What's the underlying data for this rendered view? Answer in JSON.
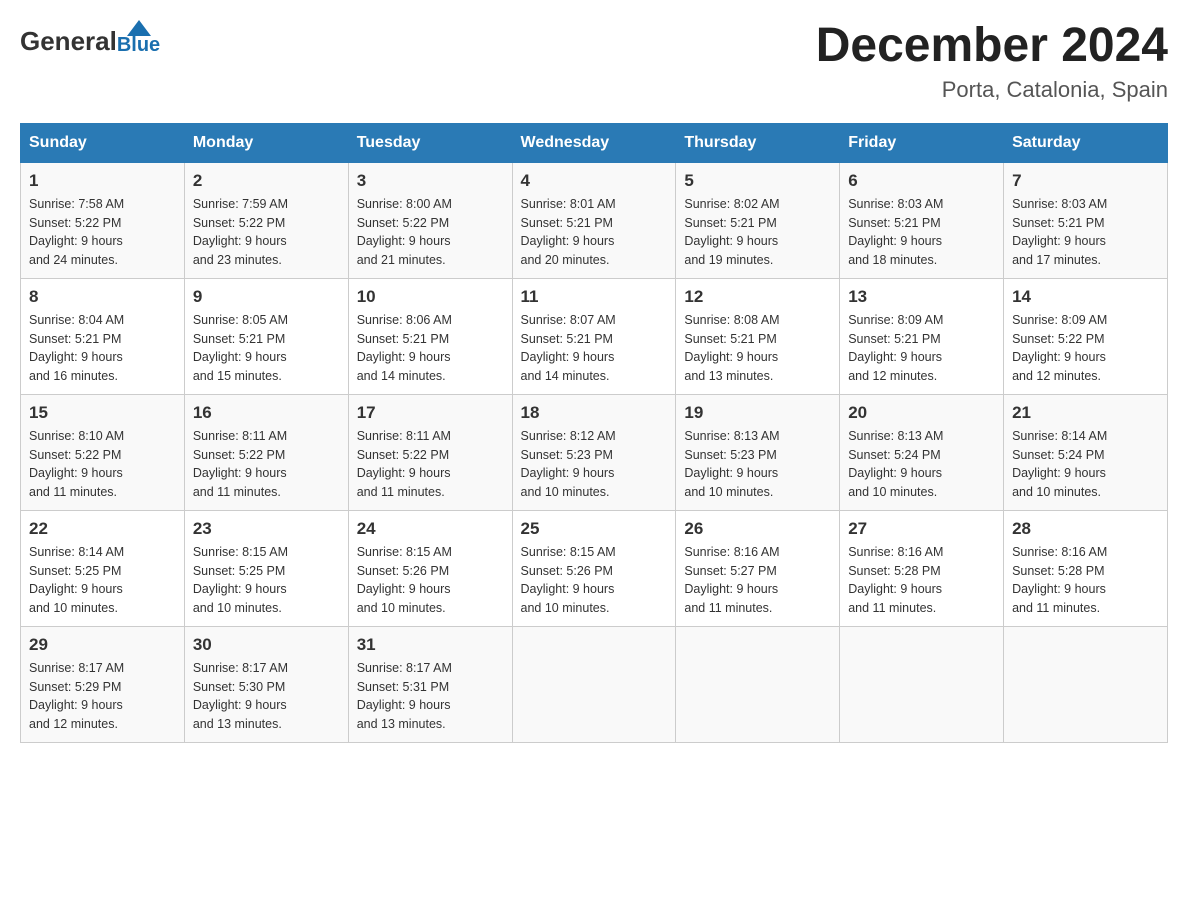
{
  "header": {
    "title": "December 2024",
    "subtitle": "Porta, Catalonia, Spain",
    "logo_general": "General",
    "logo_blue": "Blue"
  },
  "days_of_week": [
    "Sunday",
    "Monday",
    "Tuesday",
    "Wednesday",
    "Thursday",
    "Friday",
    "Saturday"
  ],
  "weeks": [
    [
      {
        "day": "1",
        "sunrise": "7:58 AM",
        "sunset": "5:22 PM",
        "daylight": "9 hours and 24 minutes."
      },
      {
        "day": "2",
        "sunrise": "7:59 AM",
        "sunset": "5:22 PM",
        "daylight": "9 hours and 23 minutes."
      },
      {
        "day": "3",
        "sunrise": "8:00 AM",
        "sunset": "5:22 PM",
        "daylight": "9 hours and 21 minutes."
      },
      {
        "day": "4",
        "sunrise": "8:01 AM",
        "sunset": "5:21 PM",
        "daylight": "9 hours and 20 minutes."
      },
      {
        "day": "5",
        "sunrise": "8:02 AM",
        "sunset": "5:21 PM",
        "daylight": "9 hours and 19 minutes."
      },
      {
        "day": "6",
        "sunrise": "8:03 AM",
        "sunset": "5:21 PM",
        "daylight": "9 hours and 18 minutes."
      },
      {
        "day": "7",
        "sunrise": "8:03 AM",
        "sunset": "5:21 PM",
        "daylight": "9 hours and 17 minutes."
      }
    ],
    [
      {
        "day": "8",
        "sunrise": "8:04 AM",
        "sunset": "5:21 PM",
        "daylight": "9 hours and 16 minutes."
      },
      {
        "day": "9",
        "sunrise": "8:05 AM",
        "sunset": "5:21 PM",
        "daylight": "9 hours and 15 minutes."
      },
      {
        "day": "10",
        "sunrise": "8:06 AM",
        "sunset": "5:21 PM",
        "daylight": "9 hours and 14 minutes."
      },
      {
        "day": "11",
        "sunrise": "8:07 AM",
        "sunset": "5:21 PM",
        "daylight": "9 hours and 14 minutes."
      },
      {
        "day": "12",
        "sunrise": "8:08 AM",
        "sunset": "5:21 PM",
        "daylight": "9 hours and 13 minutes."
      },
      {
        "day": "13",
        "sunrise": "8:09 AM",
        "sunset": "5:21 PM",
        "daylight": "9 hours and 12 minutes."
      },
      {
        "day": "14",
        "sunrise": "8:09 AM",
        "sunset": "5:22 PM",
        "daylight": "9 hours and 12 minutes."
      }
    ],
    [
      {
        "day": "15",
        "sunrise": "8:10 AM",
        "sunset": "5:22 PM",
        "daylight": "9 hours and 11 minutes."
      },
      {
        "day": "16",
        "sunrise": "8:11 AM",
        "sunset": "5:22 PM",
        "daylight": "9 hours and 11 minutes."
      },
      {
        "day": "17",
        "sunrise": "8:11 AM",
        "sunset": "5:22 PM",
        "daylight": "9 hours and 11 minutes."
      },
      {
        "day": "18",
        "sunrise": "8:12 AM",
        "sunset": "5:23 PM",
        "daylight": "9 hours and 10 minutes."
      },
      {
        "day": "19",
        "sunrise": "8:13 AM",
        "sunset": "5:23 PM",
        "daylight": "9 hours and 10 minutes."
      },
      {
        "day": "20",
        "sunrise": "8:13 AM",
        "sunset": "5:24 PM",
        "daylight": "9 hours and 10 minutes."
      },
      {
        "day": "21",
        "sunrise": "8:14 AM",
        "sunset": "5:24 PM",
        "daylight": "9 hours and 10 minutes."
      }
    ],
    [
      {
        "day": "22",
        "sunrise": "8:14 AM",
        "sunset": "5:25 PM",
        "daylight": "9 hours and 10 minutes."
      },
      {
        "day": "23",
        "sunrise": "8:15 AM",
        "sunset": "5:25 PM",
        "daylight": "9 hours and 10 minutes."
      },
      {
        "day": "24",
        "sunrise": "8:15 AM",
        "sunset": "5:26 PM",
        "daylight": "9 hours and 10 minutes."
      },
      {
        "day": "25",
        "sunrise": "8:15 AM",
        "sunset": "5:26 PM",
        "daylight": "9 hours and 10 minutes."
      },
      {
        "day": "26",
        "sunrise": "8:16 AM",
        "sunset": "5:27 PM",
        "daylight": "9 hours and 11 minutes."
      },
      {
        "day": "27",
        "sunrise": "8:16 AM",
        "sunset": "5:28 PM",
        "daylight": "9 hours and 11 minutes."
      },
      {
        "day": "28",
        "sunrise": "8:16 AM",
        "sunset": "5:28 PM",
        "daylight": "9 hours and 11 minutes."
      }
    ],
    [
      {
        "day": "29",
        "sunrise": "8:17 AM",
        "sunset": "5:29 PM",
        "daylight": "9 hours and 12 minutes."
      },
      {
        "day": "30",
        "sunrise": "8:17 AM",
        "sunset": "5:30 PM",
        "daylight": "9 hours and 13 minutes."
      },
      {
        "day": "31",
        "sunrise": "8:17 AM",
        "sunset": "5:31 PM",
        "daylight": "9 hours and 13 minutes."
      },
      null,
      null,
      null,
      null
    ]
  ],
  "labels": {
    "sunrise": "Sunrise:",
    "sunset": "Sunset:",
    "daylight": "Daylight:"
  }
}
